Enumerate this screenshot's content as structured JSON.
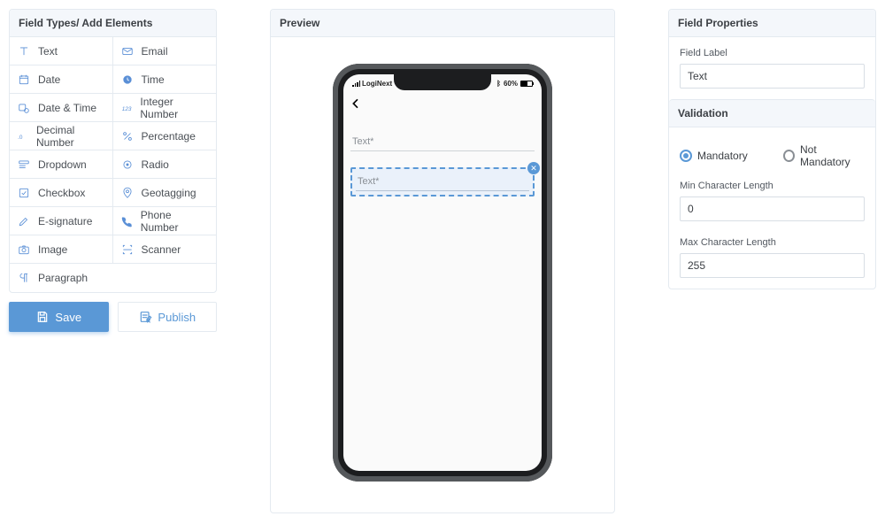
{
  "left": {
    "header": "Field Types/ Add Elements",
    "types": [
      "Text",
      "Email",
      "Date",
      "Time",
      "Date & Time",
      "Integer Number",
      "Decimal Number",
      "Percentage",
      "Dropdown",
      "Radio",
      "Checkbox",
      "Geotagging",
      "E-signature",
      "Phone Number",
      "Image",
      "Scanner",
      "Paragraph"
    ],
    "save_label": "Save",
    "publish_label": "Publish"
  },
  "preview": {
    "header": "Preview",
    "carrier": "LogiNext",
    "battery_pct": "60%",
    "field1_placeholder": "Text*",
    "field2_placeholder": "Text*"
  },
  "props": {
    "header": "Field Properties",
    "label_caption": "Field Label",
    "label_value": "Text",
    "validation_header": "Validation",
    "mandatory_label": "Mandatory",
    "not_mandatory_label": "Not Mandatory",
    "mandatory_selected": "mandatory",
    "min_label": "Min Character Length",
    "min_value": "0",
    "max_label": "Max Character Length",
    "max_value": "255"
  }
}
